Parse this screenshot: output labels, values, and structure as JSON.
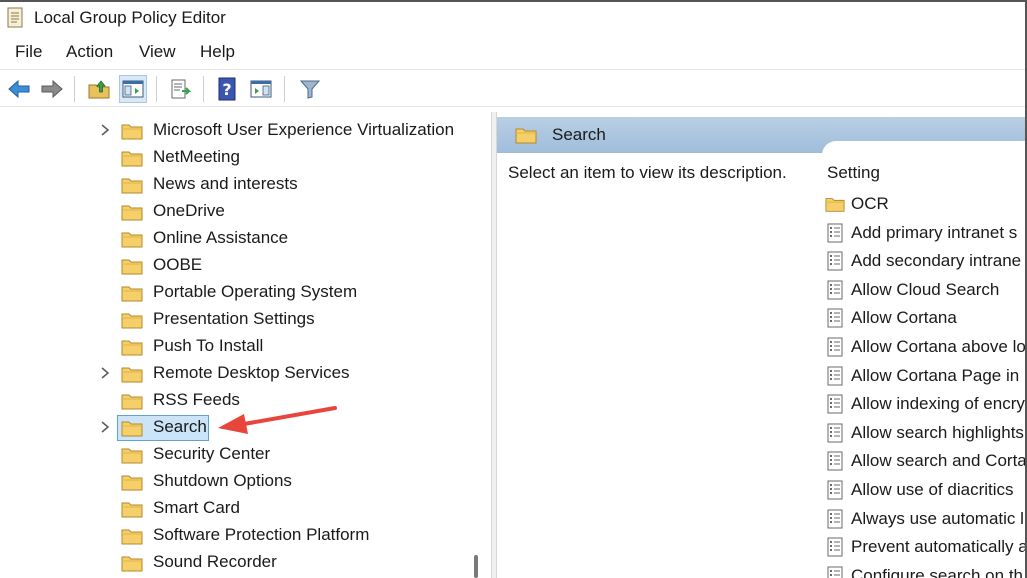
{
  "window": {
    "title": "Local Group Policy Editor"
  },
  "menu": [
    "File",
    "Action",
    "View",
    "Help"
  ],
  "toolbar": {
    "buttons": [
      "back-arrow-icon",
      "forward-arrow-icon",
      "up-folder-icon",
      "show-hide-tree-icon",
      "export-list-icon",
      "help-icon",
      "action-pane-icon",
      "filter-icon"
    ]
  },
  "tree": {
    "items": [
      {
        "label": "Microsoft User Experience Virtualization",
        "expandable": true
      },
      {
        "label": "NetMeeting",
        "expandable": false
      },
      {
        "label": "News and interests",
        "expandable": false
      },
      {
        "label": "OneDrive",
        "expandable": false
      },
      {
        "label": "Online Assistance",
        "expandable": false
      },
      {
        "label": "OOBE",
        "expandable": false
      },
      {
        "label": "Portable Operating System",
        "expandable": false
      },
      {
        "label": "Presentation Settings",
        "expandable": false
      },
      {
        "label": "Push To Install",
        "expandable": false
      },
      {
        "label": "Remote Desktop Services",
        "expandable": true
      },
      {
        "label": "RSS Feeds",
        "expandable": false
      },
      {
        "label": "Search",
        "expandable": true,
        "selected": true
      },
      {
        "label": "Security Center",
        "expandable": false
      },
      {
        "label": "Shutdown Options",
        "expandable": false
      },
      {
        "label": "Smart Card",
        "expandable": false
      },
      {
        "label": "Software Protection Platform",
        "expandable": false
      },
      {
        "label": "Sound Recorder",
        "expandable": false
      }
    ]
  },
  "details": {
    "header": "Search",
    "description": "Select an item to view its description.",
    "column_header": "Setting",
    "settings": [
      {
        "label": "OCR",
        "type": "folder"
      },
      {
        "label": "Add primary intranet s",
        "type": "policy"
      },
      {
        "label": "Add secondary intrane",
        "type": "policy"
      },
      {
        "label": "Allow Cloud Search",
        "type": "policy"
      },
      {
        "label": "Allow Cortana",
        "type": "policy"
      },
      {
        "label": "Allow Cortana above lo",
        "type": "policy"
      },
      {
        "label": "Allow Cortana Page in",
        "type": "policy"
      },
      {
        "label": "Allow indexing of encry",
        "type": "policy"
      },
      {
        "label": "Allow search highlights",
        "type": "policy"
      },
      {
        "label": "Allow search and Corta",
        "type": "policy"
      },
      {
        "label": "Allow use of diacritics",
        "type": "policy"
      },
      {
        "label": "Always use automatic l",
        "type": "policy"
      },
      {
        "label": "Prevent automatically a",
        "type": "policy"
      },
      {
        "label": "Configure search on th",
        "type": "policy"
      }
    ]
  },
  "colors": {
    "selection_bg": "#cce4f7",
    "selection_border": "#5ea2d6",
    "header_bg": "#a9c5e0",
    "folder": "#f4cf6a",
    "annotation_arrow": "#e8453c"
  }
}
